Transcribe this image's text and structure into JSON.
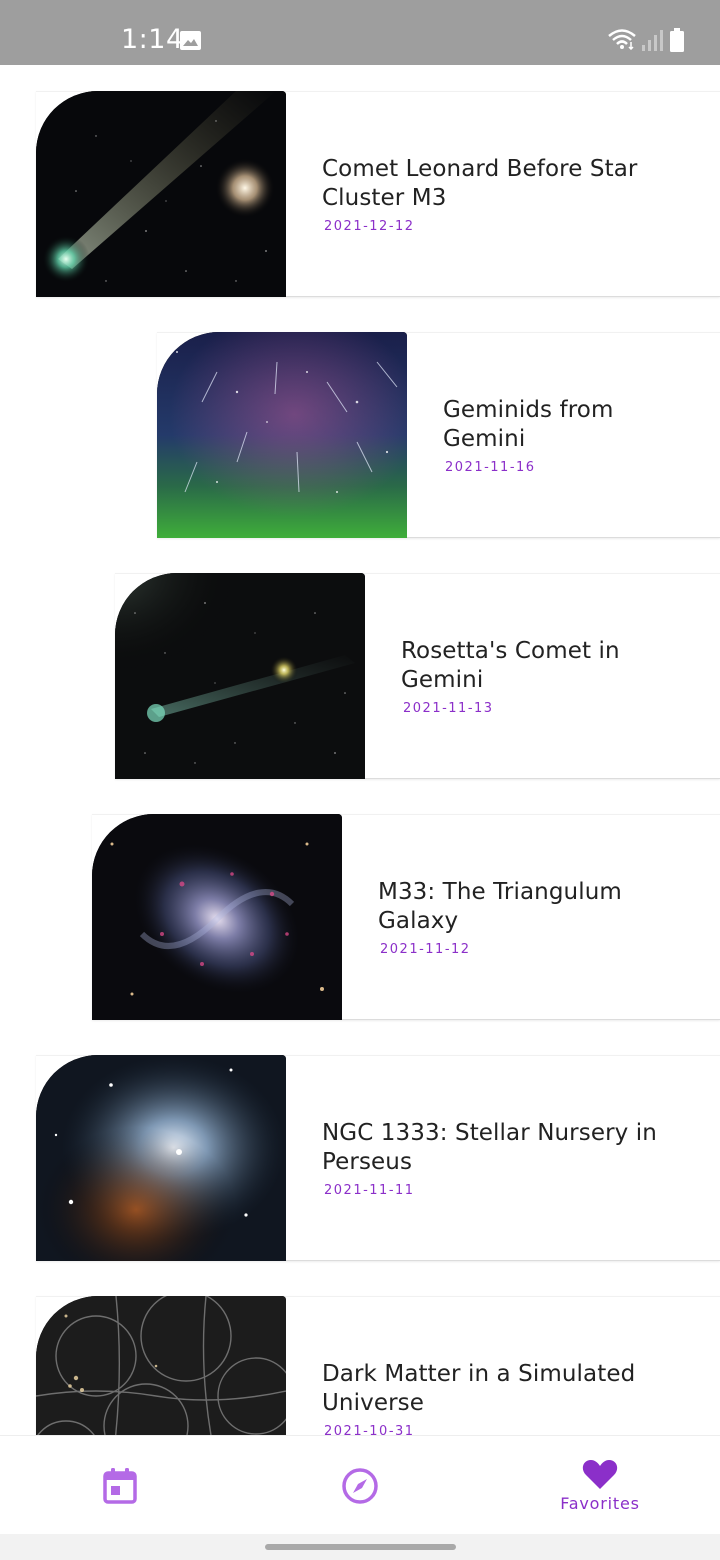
{
  "status_bar": {
    "time": "1:14"
  },
  "favorites": [
    {
      "title": "Comet Leonard Before Star Cluster M3",
      "date": "2021-12-12"
    },
    {
      "title": "Geminids from Gemini",
      "date": "2021-11-16"
    },
    {
      "title": "Rosetta's Comet in Gemini",
      "date": "2021-11-13"
    },
    {
      "title": "M33: The Triangulum Galaxy",
      "date": "2021-11-12"
    },
    {
      "title": "NGC 1333: Stellar Nursery in Perseus",
      "date": "2021-11-11"
    },
    {
      "title": "Dark Matter in a Simulated Universe",
      "date": "2021-10-31"
    }
  ],
  "bottom_nav": {
    "items": [
      {
        "icon": "calendar-icon",
        "label": ""
      },
      {
        "icon": "compass-icon",
        "label": ""
      },
      {
        "icon": "heart-icon",
        "label": "Favorites",
        "selected": true
      }
    ]
  },
  "colors": {
    "accent": "#8b2fc9",
    "accent_light": "#b46ae6",
    "status_bar": "#9e9e9e"
  }
}
